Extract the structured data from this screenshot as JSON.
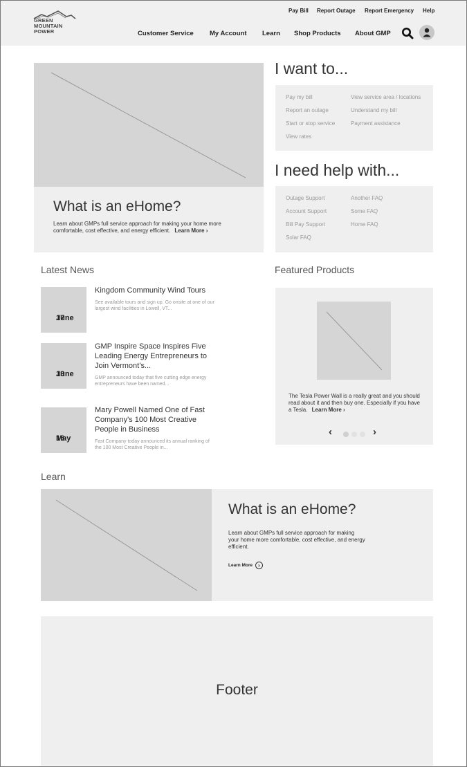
{
  "brand": {
    "logo_lines": [
      "GREEN",
      "MOUNTAIN",
      "POWER"
    ]
  },
  "utility_nav": [
    "Pay Bill",
    "Report Outage",
    "Report Emergency",
    "Help"
  ],
  "main_nav": [
    "Customer Service",
    "My Account",
    "Learn",
    "Shop Products",
    "About GMP"
  ],
  "header_icons": [
    "search-icon",
    "account-icon"
  ],
  "hero": {
    "title": "What is an eHome?",
    "text": "Learn about GMPs full service approach for making your home more comfortable, cost effective, and energy efficient.",
    "cta": "Learn More",
    "arrow": "›"
  },
  "i_want_to": {
    "heading": "I want to...",
    "col1": [
      "Pay my bill",
      "Report an outage",
      "Start or stop service",
      "View rates"
    ],
    "col2": [
      "View service area / locations",
      "Understand my bill",
      "Payment assistance"
    ]
  },
  "help_with": {
    "heading": "I need help with...",
    "col1": [
      "Outage Support",
      "Account Support",
      "Bill Pay Support",
      "Solar FAQ"
    ],
    "col2": [
      "Another FAQ",
      "Some FAQ",
      "Home FAQ"
    ]
  },
  "latest_news": {
    "heading": "Latest News",
    "items": [
      {
        "month": "June",
        "day": "17",
        "title": "Kingdom Community Wind Tours",
        "desc": "See available tours and sign up. Go onsite at one of our largest wind facilities in Lowell, VT..."
      },
      {
        "month": "June",
        "day": "13",
        "title": "GMP Inspire Space Inspires Five Leading Energy Entrepreneurs to Join Vermont’s...",
        "desc": "GMP announced today that five cutting edge energy entrepreneurs have been named..."
      },
      {
        "month": "May",
        "day": "16",
        "title": "Mary Powell Named One of Fast Company's 100 Most Creative People in Business",
        "desc": "Fast Company today announced its annual ranking of the 100 Most Creative People in..."
      }
    ]
  },
  "featured_products": {
    "heading": "Featured Products",
    "text": "The Tesla Power Wall is a really great and you should read about it and then buy one. Especially if you have a Tesla.",
    "cta": "Learn More",
    "arrow": "›",
    "prev": "‹",
    "next": "›",
    "carousel_total": 3,
    "carousel_active": 1
  },
  "learn": {
    "heading": "Learn",
    "title": "What is an eHome?",
    "text": "Learn about GMPs full service approach for making your home more comfortable, cost effective, and energy efficient.",
    "cta": "Learn More",
    "cta_icon": "›"
  },
  "footer": {
    "label": "Footer"
  },
  "colors": {
    "placeholder": "#d5d5d5",
    "panel": "#efefef",
    "header_bg": "#f0f0f1",
    "link_grey": "#999999"
  }
}
